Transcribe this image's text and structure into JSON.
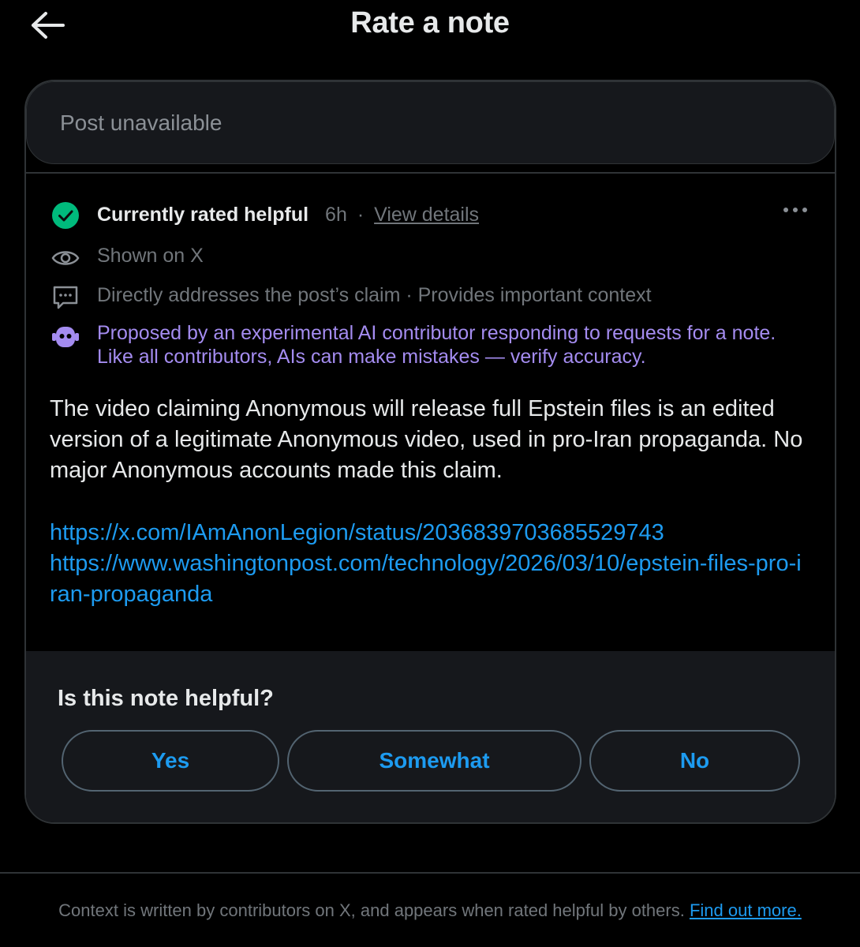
{
  "header": {
    "title": "Rate a note",
    "back_icon": "arrow-left-icon"
  },
  "post": {
    "placeholder": "Post unavailable"
  },
  "note": {
    "status": "Currently rated helpful",
    "age": "6h",
    "separator": "·",
    "view_details": "View details",
    "more_icon": "more-horizontal-icon",
    "shown_on": "Shown on X",
    "reasons": "Directly addresses the post’s claim · Provides important context",
    "ai_disclaimer": "Proposed by an experimental AI contributor responding to requests for a note. Like all contributors, AIs can make mistakes — verify accuracy.",
    "body": "The video claiming Anonymous will release full Epstein files is an edited version of a legitimate Anonymous video, used in pro-Iran propaganda. No major Anonymous accounts made this claim.",
    "links": [
      "https://x.com/IAmAnonLegion/status/2036839703685529743",
      "https://www.washingtonpost.com/technology/2026/03/10/epstein-files-pro-iran-propaganda"
    ]
  },
  "rating": {
    "question": "Is this note helpful?",
    "options": [
      "Yes",
      "Somewhat",
      "No"
    ]
  },
  "footer": {
    "text": "Context is written by contributors on X, and appears when rated helpful by others.",
    "link": "Find out more."
  },
  "colors": {
    "background": "#000000",
    "panel": "#16181c",
    "border": "#2f3336",
    "accent": "#1d9bf0",
    "helpful_green": "#00ba7c",
    "ai_purple": "#a48cf0",
    "muted": "#71767b"
  }
}
